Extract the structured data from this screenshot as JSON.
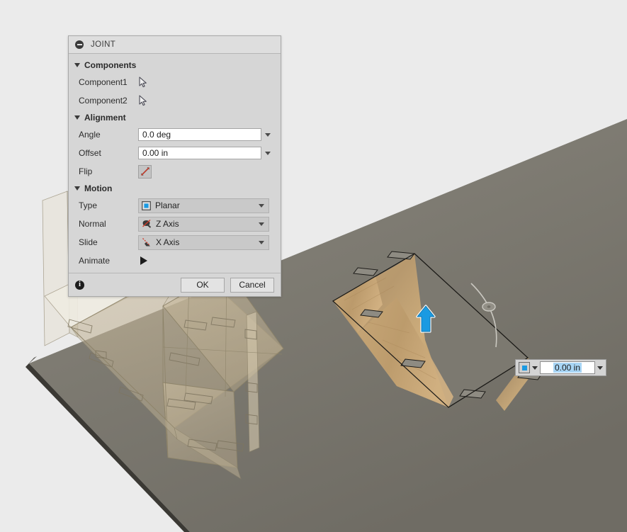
{
  "app": {
    "background_color": "#ebebeb",
    "viewport_ground_color": "#807d74",
    "wood_color": "#c9a26a"
  },
  "dialog": {
    "title": "JOINT",
    "collapse_icon": "collapse-circle-icon",
    "groups": {
      "components": {
        "label": "Components",
        "rows": [
          {
            "label": "Component1",
            "icon": "select-cursor-icon"
          },
          {
            "label": "Component2",
            "icon": "select-cursor-icon"
          }
        ]
      },
      "alignment": {
        "label": "Alignment",
        "angle": {
          "label": "Angle",
          "value": "0.0 deg"
        },
        "offset": {
          "label": "Offset",
          "value": "0.00 in"
        },
        "flip": {
          "label": "Flip",
          "icon": "flip-arrows-icon"
        }
      },
      "motion": {
        "label": "Motion",
        "type": {
          "label": "Type",
          "value": "Planar",
          "icon": "planar-joint-icon"
        },
        "normal": {
          "label": "Normal",
          "value": "Z Axis",
          "icon": "z-axis-icon"
        },
        "slide": {
          "label": "Slide",
          "value": "X Axis",
          "icon": "x-axis-icon"
        },
        "animate": {
          "label": "Animate",
          "icon": "play-icon"
        }
      }
    },
    "footer": {
      "info_icon": "i",
      "ok_label": "OK",
      "cancel_label": "Cancel"
    }
  },
  "viewport": {
    "move_arrow": "move-arrow-handle",
    "rotate_handle": "rotate-arc-handle",
    "manipulator_input": {
      "icon": "planar-joint-icon",
      "value": "0.00 in",
      "selected": true
    }
  }
}
